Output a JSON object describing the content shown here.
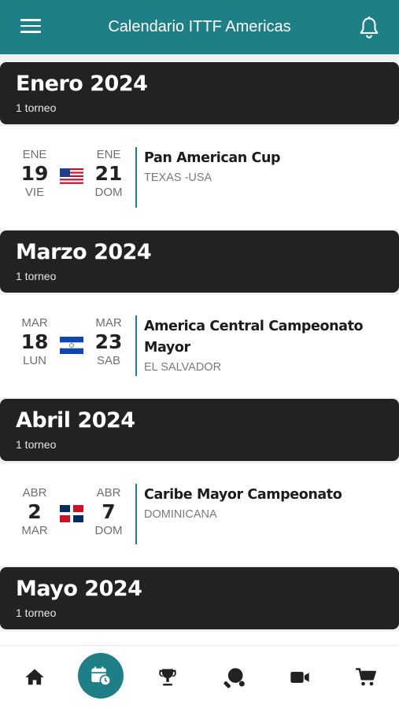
{
  "header": {
    "title": "Calendario ITTF Americas"
  },
  "months": [
    {
      "name": "Enero 2024",
      "count": "1 torneo"
    },
    {
      "name": "Marzo 2024",
      "count": "1 torneo"
    },
    {
      "name": "Abril 2024",
      "count": "1 torneo"
    },
    {
      "name": "Mayo 2024",
      "count": "1 torneo"
    }
  ],
  "events": [
    {
      "start_month": "ENE",
      "start_day": "19",
      "start_weekday": "VIE",
      "end_month": "ENE",
      "end_day": "21",
      "end_weekday": "DOM",
      "flag_icon": "usa-flag-icon",
      "name": "Pan American Cup",
      "name_line2": "",
      "location": "TEXAS -USA"
    },
    {
      "start_month": "MAR",
      "start_day": "18",
      "start_weekday": "LUN",
      "end_month": "MAR",
      "end_day": "23",
      "end_weekday": "SAB",
      "flag_icon": "el-salvador-flag-icon",
      "name": "America Central Campeonato",
      "name_line2": "Mayor",
      "location": "EL SALVADOR"
    },
    {
      "start_month": "ABR",
      "start_day": "2",
      "start_weekday": "MAR",
      "end_month": "ABR",
      "end_day": "7",
      "end_weekday": "DOM",
      "flag_icon": "dominican-republic-flag-icon",
      "name": "Caribe Mayor Campeonato",
      "name_line2": "",
      "location": "DOMINICANA"
    }
  ],
  "bottom_nav": [
    {
      "icon": "home-icon",
      "active": false
    },
    {
      "icon": "calendar-clock-icon",
      "active": true
    },
    {
      "icon": "trophy-icon",
      "active": false
    },
    {
      "icon": "table-tennis-icon",
      "active": false
    },
    {
      "icon": "video-camera-icon",
      "active": false
    },
    {
      "icon": "shopping-cart-icon",
      "active": false
    }
  ],
  "colors": {
    "primary": "#1f7f86",
    "month_header": "#222222",
    "background": "#f1f1f1"
  }
}
